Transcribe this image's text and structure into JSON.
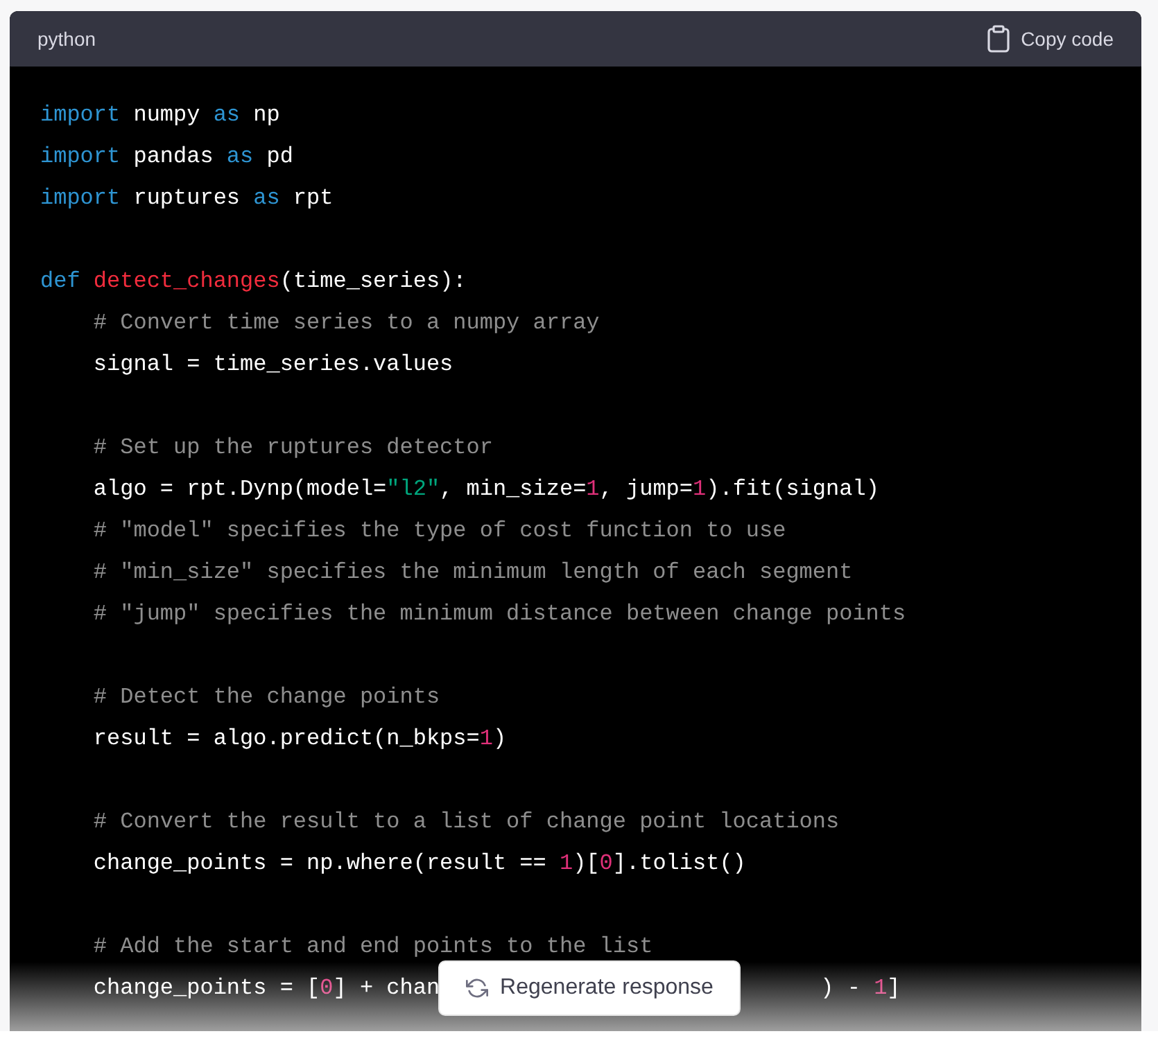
{
  "code_block": {
    "language": "python",
    "copy_label": "Copy code",
    "lines": [
      {
        "kind": "code",
        "indented": false,
        "tokens": [
          {
            "kind": "keyword",
            "text": "import"
          },
          {
            "kind": "plain",
            "text": " numpy "
          },
          {
            "kind": "keyword",
            "text": "as"
          },
          {
            "kind": "plain",
            "text": " np"
          }
        ]
      },
      {
        "kind": "code",
        "indented": false,
        "tokens": [
          {
            "kind": "keyword",
            "text": "import"
          },
          {
            "kind": "plain",
            "text": " pandas "
          },
          {
            "kind": "keyword",
            "text": "as"
          },
          {
            "kind": "plain",
            "text": " pd"
          }
        ]
      },
      {
        "kind": "code",
        "indented": false,
        "tokens": [
          {
            "kind": "keyword",
            "text": "import"
          },
          {
            "kind": "plain",
            "text": " ruptures "
          },
          {
            "kind": "keyword",
            "text": "as"
          },
          {
            "kind": "plain",
            "text": " rpt"
          }
        ]
      },
      {
        "kind": "blank"
      },
      {
        "kind": "code",
        "indented": false,
        "tokens": [
          {
            "kind": "keyword",
            "text": "def"
          },
          {
            "kind": "function",
            "text": " detect_changes"
          },
          {
            "kind": "plain",
            "text": "(time_series):"
          }
        ]
      },
      {
        "kind": "code",
        "indented": true,
        "tokens": [
          {
            "kind": "comment",
            "text": "# Convert time series to a numpy array"
          }
        ]
      },
      {
        "kind": "code",
        "indented": true,
        "tokens": [
          {
            "kind": "plain",
            "text": "signal = time_series.values"
          }
        ]
      },
      {
        "kind": "blank"
      },
      {
        "kind": "code",
        "indented": true,
        "tokens": [
          {
            "kind": "comment",
            "text": "# Set up the ruptures detector"
          }
        ]
      },
      {
        "kind": "code",
        "indented": true,
        "tokens": [
          {
            "kind": "plain",
            "text": "algo = rpt.Dynp(model="
          },
          {
            "kind": "string",
            "text": "\"l2\""
          },
          {
            "kind": "plain",
            "text": ", min_size="
          },
          {
            "kind": "number",
            "text": "1"
          },
          {
            "kind": "plain",
            "text": ", jump="
          },
          {
            "kind": "number",
            "text": "1"
          },
          {
            "kind": "plain",
            "text": ").fit(signal)"
          }
        ]
      },
      {
        "kind": "code",
        "indented": true,
        "tokens": [
          {
            "kind": "comment",
            "text": "# \"model\" specifies the type of cost function to use"
          }
        ]
      },
      {
        "kind": "code",
        "indented": true,
        "tokens": [
          {
            "kind": "comment",
            "text": "# \"min_size\" specifies the minimum length of each segment"
          }
        ]
      },
      {
        "kind": "code",
        "indented": true,
        "tokens": [
          {
            "kind": "comment",
            "text": "# \"jump\" specifies the minimum distance between change points"
          }
        ]
      },
      {
        "kind": "blank"
      },
      {
        "kind": "code",
        "indented": true,
        "tokens": [
          {
            "kind": "comment",
            "text": "# Detect the change points"
          }
        ]
      },
      {
        "kind": "code",
        "indented": true,
        "tokens": [
          {
            "kind": "plain",
            "text": "result = algo.predict(n_bkps="
          },
          {
            "kind": "number",
            "text": "1"
          },
          {
            "kind": "plain",
            "text": ")"
          }
        ]
      },
      {
        "kind": "blank"
      },
      {
        "kind": "code",
        "indented": true,
        "tokens": [
          {
            "kind": "comment",
            "text": "# Convert the result to a list of change point locations"
          }
        ]
      },
      {
        "kind": "code",
        "indented": true,
        "tokens": [
          {
            "kind": "plain",
            "text": "change_points = np.where(result == "
          },
          {
            "kind": "number",
            "text": "1"
          },
          {
            "kind": "plain",
            "text": ")["
          },
          {
            "kind": "number",
            "text": "0"
          },
          {
            "kind": "plain",
            "text": "].tolist()"
          }
        ]
      },
      {
        "kind": "blank"
      },
      {
        "kind": "code",
        "indented": true,
        "tokens": [
          {
            "kind": "comment",
            "text": "# Add the start and end points to the list"
          }
        ]
      },
      {
        "kind": "code",
        "indented": true,
        "tokens": [
          {
            "kind": "plain",
            "text": "change_points = ["
          },
          {
            "kind": "number",
            "text": "0"
          },
          {
            "kind": "plain",
            "text": "] + chan"
          },
          {
            "kind": "gap"
          },
          {
            "kind": "plain",
            "text": ") - "
          },
          {
            "kind": "number",
            "text": "1"
          },
          {
            "kind": "plain",
            "text": "]"
          }
        ]
      }
    ]
  },
  "regenerate_button": {
    "label": "Regenerate response"
  }
}
